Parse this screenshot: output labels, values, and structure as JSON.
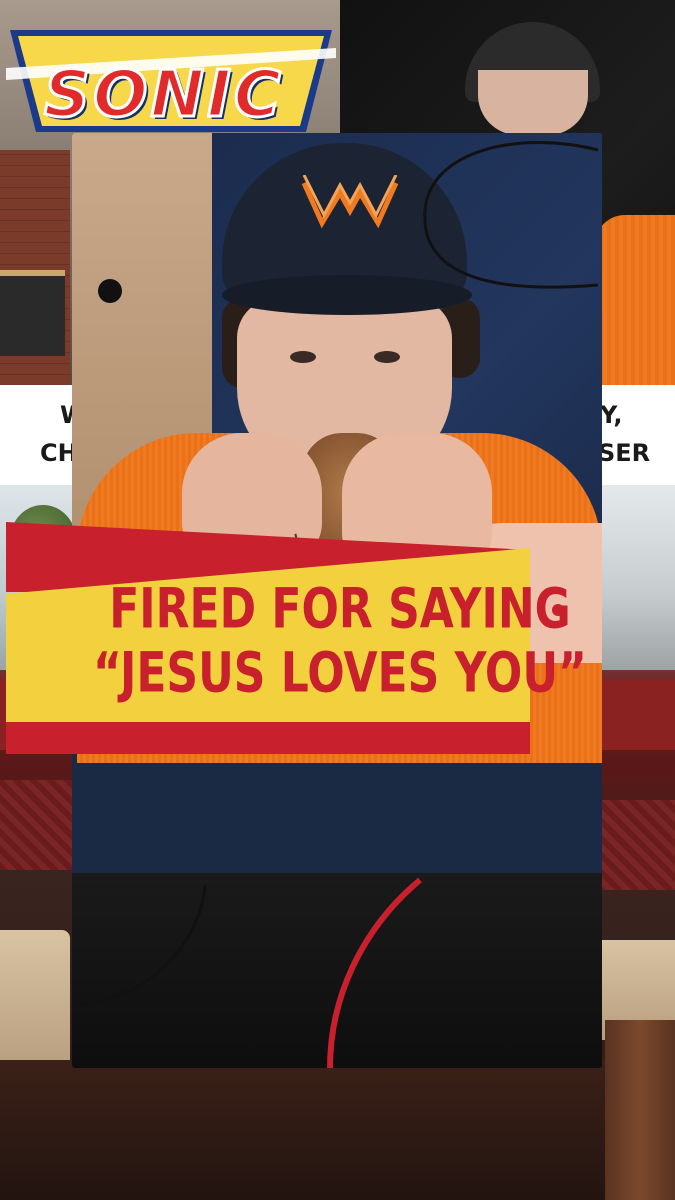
{
  "sonic_logo": {
    "text": "SONIC"
  },
  "background_strip": {
    "left_line_1": "W",
    "left_line_2": "CH",
    "right_line_1": "Y,",
    "right_line_2": "SER"
  },
  "headline": {
    "line_1": "FIRED FOR SAYING",
    "line_2": "“JESUS LOVES YOU”"
  },
  "colors": {
    "headline_red": "#c8202c",
    "headline_yellow": "#f3d03e",
    "uniform_orange": "#f07a1f",
    "hat_navy": "#1c2434"
  },
  "icons": {
    "hat_logo": "whataburger-w-icon"
  }
}
